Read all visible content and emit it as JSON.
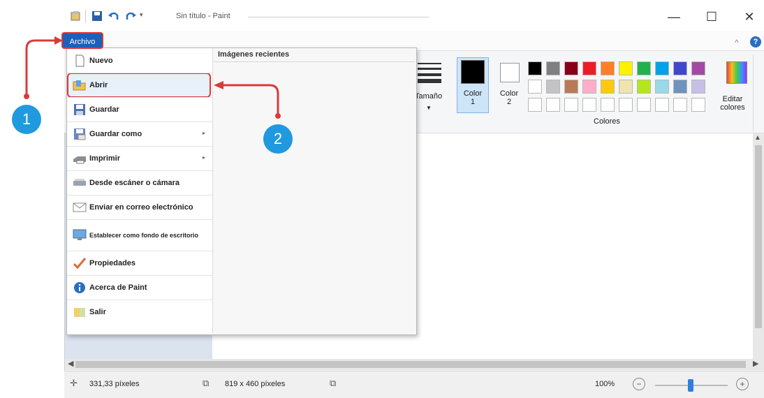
{
  "window": {
    "title": "Sin título - Paint",
    "minimize": "—",
    "maximize": "☐",
    "close": "✕"
  },
  "ribbon": {
    "file_tab": "Archivo",
    "size_label": "Tamaño",
    "color1_label": "Color 1",
    "color2_label": "Color 2",
    "colors_group": "Colores",
    "edit_colors": "Editar colores",
    "palette_row1": [
      "#000000",
      "#7f7f7f",
      "#880015",
      "#ed1c24",
      "#ff7f27",
      "#fff200",
      "#22b14c",
      "#00a2e8",
      "#3f48cc",
      "#a349a4"
    ],
    "palette_row2": [
      "#ffffff",
      "#c3c3c3",
      "#b97a57",
      "#ffaec9",
      "#ffc90e",
      "#efe4b0",
      "#b5e61d",
      "#99d9ea",
      "#7092be",
      "#c8bfe7"
    ]
  },
  "file_menu": {
    "recent_header": "Imágenes recientes",
    "items": [
      {
        "label": "Nuevo",
        "icon": "new-file-icon"
      },
      {
        "label": "Abrir",
        "icon": "open-folder-icon"
      },
      {
        "label": "Guardar",
        "icon": "save-disk-icon"
      },
      {
        "label": "Guardar como",
        "icon": "save-as-icon",
        "submenu": true
      },
      {
        "label": "Imprimir",
        "icon": "printer-icon",
        "submenu": true
      },
      {
        "label": "Desde escáner o cámara",
        "icon": "scanner-icon"
      },
      {
        "label": "Enviar en correo electrónico",
        "icon": "email-icon"
      },
      {
        "label": "Establecer como fondo de escritorio",
        "icon": "desktop-background-icon",
        "submenu": true
      },
      {
        "label": "Propiedades",
        "icon": "checkmark-icon"
      },
      {
        "label": "Acerca de Paint",
        "icon": "info-icon"
      },
      {
        "label": "Salir",
        "icon": "exit-icon"
      }
    ]
  },
  "status": {
    "cursor_position": "331,33 píxeles",
    "canvas_size": "819 x 460 píxeles",
    "zoom": "100%",
    "zoom_minus": "−",
    "zoom_plus": "+"
  },
  "annotations": {
    "step1": "1",
    "step2": "2",
    "color": "#2199de",
    "highlight_color": "#d93a3a"
  }
}
